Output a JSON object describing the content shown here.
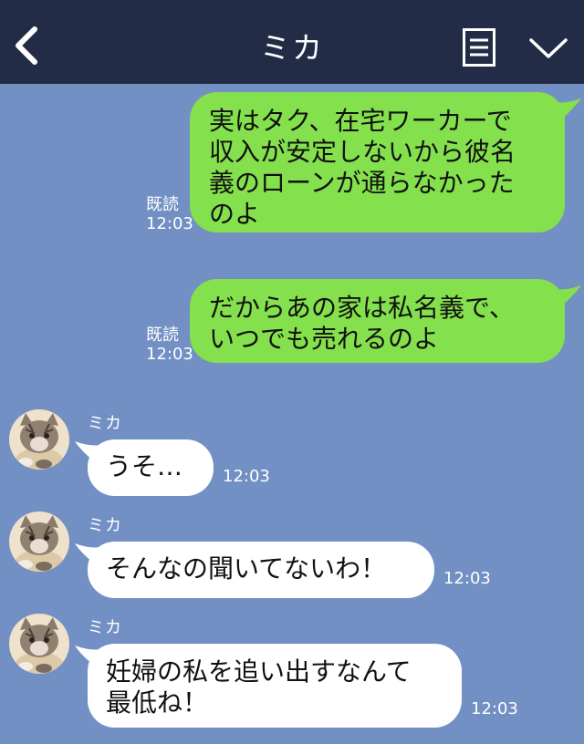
{
  "header": {
    "title": "ミカ",
    "back_icon": "chevron-left-icon",
    "memo_icon": "notes-icon",
    "menu_icon": "chevron-down-icon",
    "background": "#222c47"
  },
  "chat": {
    "background": "#7290c4",
    "sent_bubble_color": "#84e04c",
    "received_bubble_color": "#ffffff",
    "messages": [
      {
        "direction": "sent",
        "text": "実はタク、在宅ワーカーで\n収入が安定しないから彼名\n義のローンが通らなかった\nのよ",
        "read_label": "既読",
        "time": "12:03"
      },
      {
        "direction": "sent",
        "text": "だからあの家は私名義で、\nいつでも売れるのよ",
        "read_label": "既読",
        "time": "12:03"
      },
      {
        "direction": "received",
        "sender": "ミカ",
        "text": "うそ…",
        "time": "12:03"
      },
      {
        "direction": "received",
        "sender": "ミカ",
        "text": "そんなの聞いてないわ！",
        "time": "12:03"
      },
      {
        "direction": "received",
        "sender": "ミカ",
        "text": "妊婦の私を追い出すなんて\n最低ね！",
        "time": "12:03"
      }
    ]
  }
}
